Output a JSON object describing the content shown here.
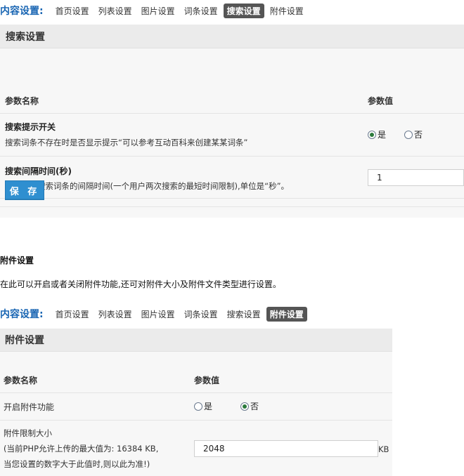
{
  "nav1": {
    "label": "内容设置:",
    "items": [
      "首页设置",
      "列表设置",
      "图片设置",
      "词条设置",
      "搜索设置",
      "附件设置"
    ],
    "active_index": 4
  },
  "search_panel": {
    "title": "搜索设置",
    "col_name": "参数名称",
    "col_value": "参数值",
    "params": [
      {
        "title": "搜索提示开关",
        "desc": "搜索词条不存在时是否显示提示“可以参考互动百科来创建某某词条”",
        "options": [
          "是",
          "否"
        ],
        "selected": "是"
      },
      {
        "title": "搜索间隔时间(秒)",
        "desc": "设置前台搜索词条的间隔时间(一个用户两次搜索的最短时间限制),单位是“秒”。",
        "value": "1"
      }
    ],
    "save_label": "保 存"
  },
  "attachment_section": {
    "title": "附件设置",
    "desc": "在此可以开启或者关闭附件功能,还可对附件大小及附件文件类型进行设置。"
  },
  "nav2": {
    "label": "内容设置:",
    "items": [
      "首页设置",
      "列表设置",
      "图片设置",
      "词条设置",
      "搜索设置",
      "附件设置"
    ],
    "active_index": 5
  },
  "attach_panel": {
    "title": "附件设置",
    "col_name": "参数名称",
    "col_value": "参数值",
    "enable": {
      "label": "开启附件功能",
      "options": [
        "是",
        "否"
      ],
      "selected": "否"
    },
    "limit": {
      "line1": "附件限制大小",
      "line2": "(当前PHP允许上传的最大值为: 16384 KB,",
      "line3": "当您设置的数字大于此值时,则以此为准!)",
      "value": "2048",
      "unit": "KB"
    }
  },
  "colors": {
    "nav_label": "#1a66b3",
    "active_tab": "#555555",
    "save_button": "#2f8fd0",
    "radio_checked": "#2b7a3b"
  }
}
